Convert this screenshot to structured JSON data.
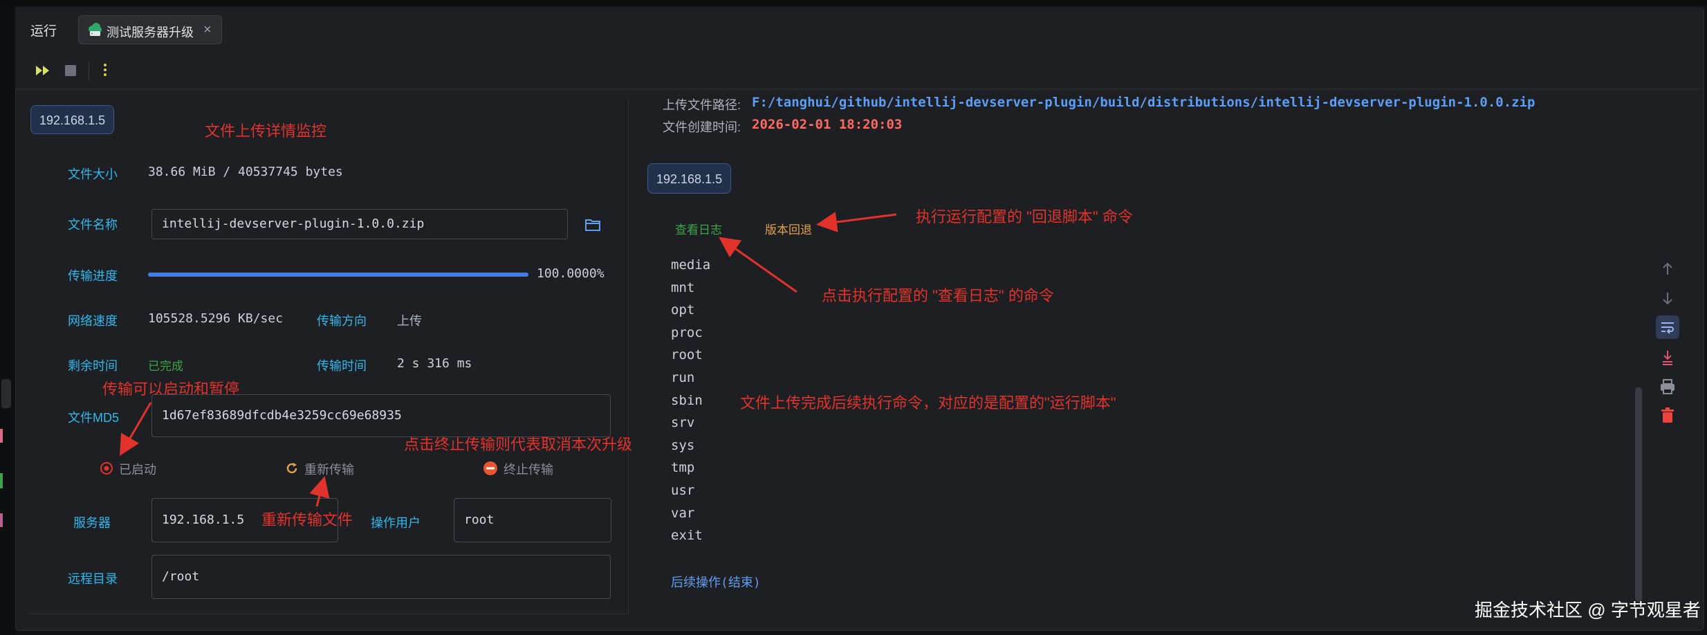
{
  "tabbar": {
    "run_label": "运行",
    "tab_label": "测试服务器升级",
    "tab_close": "×"
  },
  "upload": {
    "server_badge": "192.168.1.5",
    "size_label": "文件大小",
    "size_value": "38.66 MiB / 40537745 bytes",
    "name_label": "文件名称",
    "name_value": "intellij-devserver-plugin-1.0.0.zip",
    "progress_label": "传输进度",
    "progress_fraction": 1.0,
    "progress_text": "100.0000%",
    "speed_label": "网络速度",
    "speed_value": "105528.5296 KB/sec",
    "direction_label": "传输方向",
    "direction_value": "上传",
    "remaining_label": "剩余时间",
    "remaining_value": "已完成",
    "duration_label": "传输时间",
    "duration_value": "2 s 316 ms",
    "md5_label": "文件MD5",
    "md5_value": "1d67ef83689dfcdb4e3259cc69e68935",
    "started_label": "已启动",
    "retransmit_label": "重新传输",
    "stop_label": "终止传输",
    "server_label": "服务器",
    "server_value": "192.168.1.5",
    "user_label": "操作用户",
    "user_value": "root",
    "remote_dir_label": "远程目录",
    "remote_dir_value": "/root"
  },
  "annotations": {
    "monitor": "文件上传详情监控",
    "start_pause": "传输可以启动和暂停",
    "stop_cancel": "点击终止传输则代表取消本次升级",
    "retransmit": "重新传输文件",
    "rollback": "执行运行配置的 \"回退脚本\" 命令",
    "view_log": "点击执行配置的 \"查看日志\" 的命令",
    "run_script": "文件上传完成后续执行命令，对应的是配置的\"运行脚本\""
  },
  "console": {
    "path_label": "上传文件路径:",
    "path_value": "F:/tanghui/github/intellij-devserver-plugin/build/distributions/intellij-devserver-plugin-1.0.0.zip",
    "created_label": "文件创建时间:",
    "created_value": "2026-02-01 18:20:03",
    "server_badge": "192.168.1.5",
    "view_log_link": "查看日志",
    "rollback_link": "版本回退",
    "lines": [
      "media",
      "mnt",
      "opt",
      "proc",
      "root",
      "run",
      "sbin",
      "srv",
      "sys",
      "tmp",
      "usr",
      "var",
      "exit"
    ],
    "footer": "后续操作(结束)"
  },
  "watermark": "掘金技术社区 @ 字节观星者",
  "colors": {
    "label_cyan": "#30b8ec",
    "path_blue": "#5e9ef5",
    "time_red": "#ff6b62",
    "annotation_red": "#e1332c",
    "link_green": "#3ba545",
    "link_orange": "#e0a24a",
    "progress_blue": "#3f7ee8"
  },
  "icons": [
    "run-all-icon",
    "stop-icon",
    "more-vertical-icon",
    "server-cloud-icon",
    "folder-icon",
    "record-icon",
    "refresh-icon",
    "stop-circle-icon",
    "arrow-up-icon",
    "arrow-down-icon",
    "soft-wrap-icon",
    "scroll-to-end-icon",
    "print-icon",
    "trash-icon"
  ]
}
